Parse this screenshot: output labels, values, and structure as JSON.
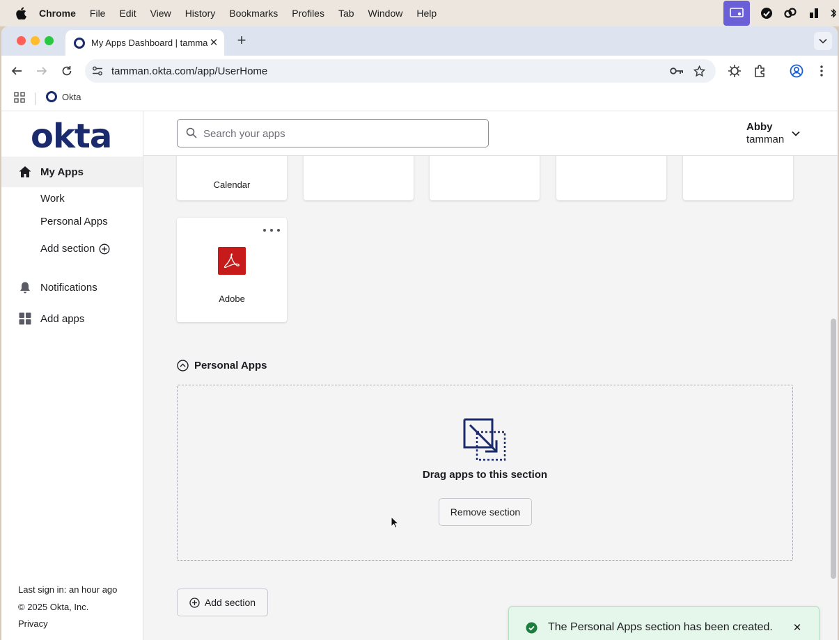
{
  "menubar": {
    "items": [
      "Chrome",
      "File",
      "Edit",
      "View",
      "History",
      "Bookmarks",
      "Profiles",
      "Tab",
      "Window",
      "Help"
    ]
  },
  "browser": {
    "tab_title": "My Apps Dashboard | tamman",
    "url": "tamman.okta.com/app/UserHome",
    "bookmark_label": "Okta"
  },
  "sidebar": {
    "logo": "okta",
    "my_apps": "My Apps",
    "sections": [
      "Work",
      "Personal Apps"
    ],
    "add_section": "Add section",
    "notifications": "Notifications",
    "add_apps": "Add apps",
    "footer": {
      "last_sign_in": "Last sign in: an hour ago",
      "copyright": "© 2025 Okta, Inc.",
      "privacy": "Privacy"
    }
  },
  "header": {
    "search_placeholder": "Search your apps",
    "user_name": "Abby",
    "user_org": "tamman"
  },
  "apps": {
    "partial_tile_label": "Calendar",
    "adobe_label": "Adobe"
  },
  "personal_section": {
    "title": "Personal Apps",
    "drop_text": "Drag apps to this section",
    "remove_button": "Remove section"
  },
  "add_section_button": "Add section",
  "toast": {
    "message": "The Personal Apps section has been created.",
    "status_color": "#1a7f3c"
  },
  "colors": {
    "okta_brand": "#1a2a6c",
    "adobe_red": "#c71b1b",
    "toast_bg": "#e5f6ea"
  }
}
